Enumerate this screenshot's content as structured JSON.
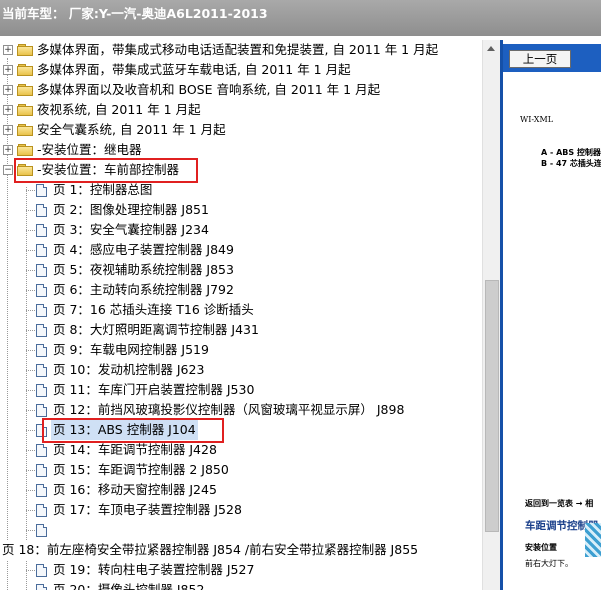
{
  "header": {
    "text": "当前车型： 厂家:Y-一汽-奥迪A6L2011-2013"
  },
  "tree": {
    "folders": [
      "多媒体界面，带集成式移动电话适配装置和免提装置, 自 2011 年 1 月起",
      "多媒体界面，带集成式蓝牙车载电话, 自 2011 年 1 月起",
      "多媒体界面以及收音机和 BOSE 音响系统, 自 2011 年 1 月起",
      "夜视系统, 自 2011 年 1 月起",
      "安全气囊系统, 自 2011 年 1 月起",
      "-安装位置：继电器",
      "-安装位置：车前部控制器"
    ],
    "expand_plus": "+",
    "expand_minus": "−",
    "pages": [
      "页 1：控制器总图",
      "页 2：图像处理控制器 J851",
      "页 3：安全气囊控制器 J234",
      "页 4：感应电子装置控制器 J849",
      "页 5：夜视辅助系统控制器 J853",
      "页 6：主动转向系统控制器 J792",
      "页 7：16 芯插头连接 T16 诊断插头",
      "页 8：大灯照明距离调节控制器 J431",
      "页 9：车载电网控制器 J519",
      "页 10：发动机控制器 J623",
      "页 11：车库门开启装置控制器 J530",
      "页 12：前挡风玻璃投影仪控制器（风窗玻璃平视显示屏） J898",
      "页 13：ABS 控制器 J104",
      "页 14：车距调节控制器 J428",
      "页 15：车距调节控制器 2 J850",
      "页 16：移动天窗控制器 J245",
      "页 17：车顶电子装置控制器 J528",
      ""
    ],
    "page18": "页 18：前左座椅安全带拉紧器控制器 J854 /前右安全带拉紧器控制器 J855",
    "pages_after": [
      "页 19：转向柱电子装置控制器 J527",
      "页 20：摄像头控制器 J852"
    ]
  },
  "preview": {
    "prev_button": "上一页",
    "wi_xml": "WI-XML",
    "line_a": "A - ABS 控制器",
    "line_b": "B - 47 芯插头连",
    "return_text": "返回到一览表 → 相",
    "title": "车距调节控制器",
    "install_label": "安装位置",
    "install_text": "前右大灯下。",
    "nav_color": "#1d5fc0"
  }
}
